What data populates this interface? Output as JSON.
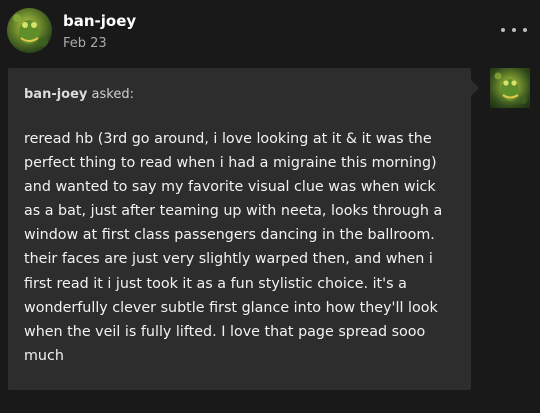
{
  "post": {
    "author": "ban-joey",
    "date": "Feb 23",
    "more_icon": "more-horizontal-icon"
  },
  "ask": {
    "asker": "ban-joey",
    "asked_suffix": " asked:",
    "question_lines": [
      "reread hb (3rd go around, i love looking at it & it was the",
      "perfect thing to read when i had a migraine this morning)",
      "and wanted to say my favorite visual clue was when wick",
      "as a bat, just after teaming up with neeta, looks through a",
      "window at first class passengers dancing in the ballroom.",
      "their faces are just very slightly warped then, and when i",
      "first read it i just took it as a fun stylistic choice. it's a",
      "wonderfully clever subtle first glance into how they'll look",
      "when the veil is fully lifted. I love that page spread sooo",
      "much"
    ]
  },
  "colors": {
    "background": "#191919",
    "bubble": "#2d2d2d",
    "secondary_text": "#a9a9a9"
  }
}
